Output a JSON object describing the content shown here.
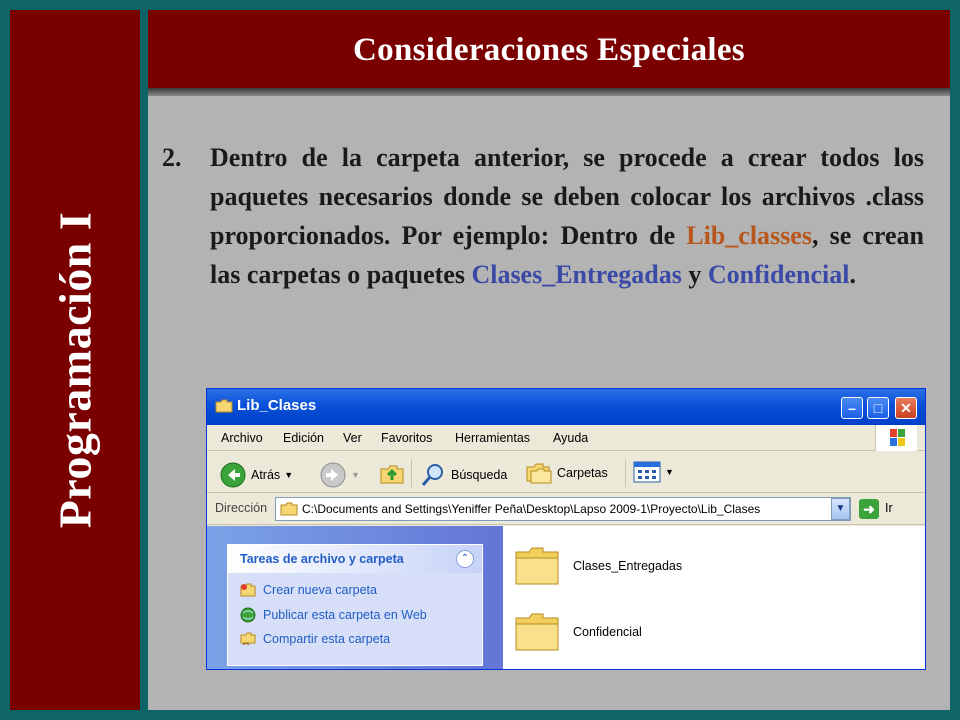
{
  "slide": {
    "sidebar_title": "Programación I",
    "header_title": "Consideraciones Especiales",
    "paragraph": {
      "number": "2.",
      "text_before": "Dentro de la carpeta anterior, se procede a crear todos los paquetes necesarios donde se deben colocar los archivos .class proporcionados. Por ejemplo: Dentro de ",
      "highlight_1": "Lib_classes",
      "text_middle": ", se crean las carpetas o paquetes ",
      "highlight_2": "Clases_Entregadas",
      "text_and": " y ",
      "highlight_3": "Confidencial",
      "text_end": "."
    }
  },
  "explorer": {
    "window_title": "Lib_Clases",
    "menu": [
      "Archivo",
      "Edición",
      "Ver",
      "Favoritos",
      "Herramientas",
      "Ayuda"
    ],
    "toolbar": {
      "back": "Atrás",
      "search": "Búsqueda",
      "folders": "Carpetas"
    },
    "address": {
      "label": "Dirección",
      "path": "C:\\Documents and Settings\\Yeniffer Peña\\Desktop\\Lapso 2009-1\\Proyecto\\Lib_Clases",
      "go": "Ir"
    },
    "tasks": {
      "title": "Tareas de archivo y carpeta",
      "items": [
        "Crear nueva carpeta",
        "Publicar esta carpeta en Web",
        "Compartir esta carpeta"
      ]
    },
    "files": [
      "Clases_Entregadas",
      "Confidencial"
    ]
  },
  "colors": {
    "frame_teal": "#0e6466",
    "maroon": "#7a0000",
    "content_gray": "#b3b3b3",
    "highlight_orange": "#b8561c",
    "highlight_blue": "#3a4aa6"
  }
}
